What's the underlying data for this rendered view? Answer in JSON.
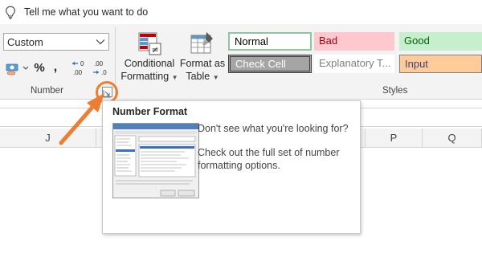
{
  "tellme": {
    "icon": "lightbulb-icon",
    "text": "Tell me what you want to do"
  },
  "number_group": {
    "format_value": "Custom",
    "percent_label": "%",
    "comma_label": ",",
    "increase_decimal_icon": "increase-decimal-icon",
    "decrease_decimal_icon": "decrease-decimal-icon",
    "currency_icon": "accounting-format-icon",
    "label": "Number"
  },
  "styles_group": {
    "conditional_formatting": {
      "line1": "Conditional",
      "line2": "Formatting"
    },
    "format_as_table": {
      "line1": "Format as",
      "line2": "Table"
    },
    "cells": {
      "normal": "Normal",
      "bad": "Bad",
      "good": "Good",
      "check_cell": "Check Cell",
      "explanatory": "Explanatory T...",
      "input": "Input"
    },
    "label": "Styles"
  },
  "columns": [
    "J",
    "P",
    "Q"
  ],
  "tooltip": {
    "title": "Number Format",
    "line1": "Don't see what you're looking for?",
    "line2": "Check out the full set of number formatting options."
  },
  "colors": {
    "accent_orange": "#ed7d31",
    "bad_bg": "#ffc7ce",
    "good_bg": "#c6efce",
    "input_bg": "#ffcc99",
    "check_bg": "#a5a5a5"
  }
}
